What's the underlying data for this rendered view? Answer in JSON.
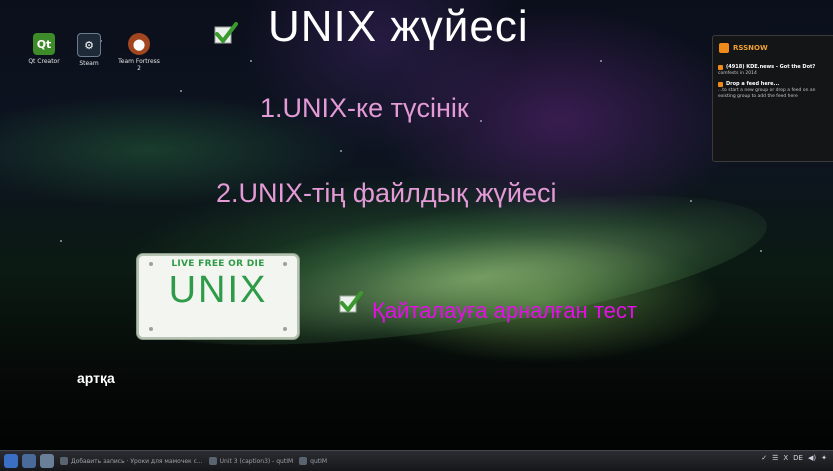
{
  "desktop": {
    "icons": [
      {
        "label": "Qt Creator",
        "glyph": "Qt"
      },
      {
        "label": "Steam",
        "glyph": "⚙"
      },
      {
        "label": "Team Fortress 2",
        "glyph": "⬤"
      }
    ]
  },
  "slide": {
    "title": "UNIX  жүйесі",
    "item1": "1.UNIX-ке түсінік",
    "item2": "2.UNIX-тің файлдық жүйесі",
    "test_link": "Қайталауға арналған тест",
    "back_link": "артқа",
    "plate": {
      "top_text": "LIVE FREE OR DIE",
      "big_text": "UNIX"
    }
  },
  "rss_widget": {
    "brand": "RSSNOW",
    "entries": [
      {
        "title": "(4918) KDE.news - Got the Dot?",
        "body": "comfests in 2014"
      },
      {
        "title": "Drop a feed here...",
        "body": "...to start a new group or drop a feed on an existing group to add the feed here"
      }
    ]
  },
  "taskbar": {
    "tasks": [
      "Добавить запись · Уроки для мамочек с...",
      "Unit 3 (caption3) - qutIM",
      "qutIM"
    ],
    "tray": [
      "✓",
      "☰",
      "X",
      "DE",
      "◀)",
      "✦"
    ]
  },
  "colors": {
    "title": "#ffffff",
    "items": "#e39ad6",
    "test_link": "#e60ee8",
    "check": "#3a9a2e",
    "plate_green": "#2e9b49",
    "rss_accent": "#f08a1a"
  }
}
